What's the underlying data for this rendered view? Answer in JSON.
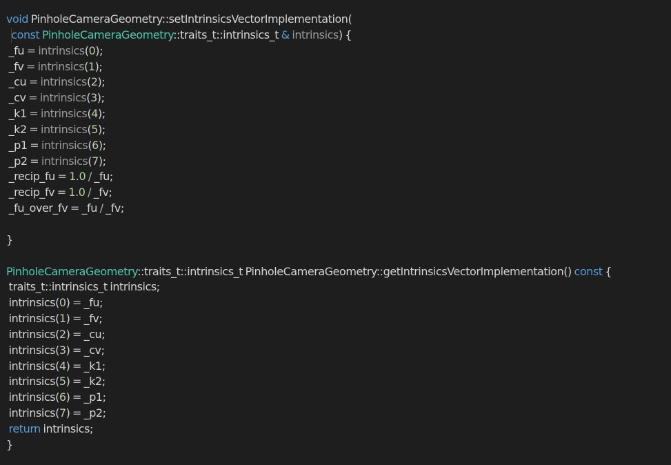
{
  "theme": {
    "background": "#1e1e1e",
    "keyword": "#569cd6",
    "type": "#4ec9b0",
    "text": "#d4d4d4",
    "number": "#b5cea8",
    "muted": "#9a9a9a"
  },
  "code": {
    "lines": [
      [
        {
          "t": "void",
          "c": "kw"
        },
        {
          "t": " PinholeCameraGeometry::setIntrinsicsVectorImplementation(",
          "c": "plain"
        }
      ],
      [
        {
          "t": "  ",
          "c": "plain",
          "guide": true
        },
        {
          "t": "const",
          "c": "kw"
        },
        {
          "t": " ",
          "c": "plain"
        },
        {
          "t": "PinholeCameraGeometry",
          "c": "type"
        },
        {
          "t": "::traits_t::intrinsics_t ",
          "c": "plain"
        },
        {
          "t": "&",
          "c": "kw"
        },
        {
          "t": " ",
          "c": "plain"
        },
        {
          "t": "intrinsics",
          "c": "param"
        },
        {
          "t": ") {",
          "c": "plain"
        }
      ],
      [
        {
          "t": " _fu ",
          "c": "plain"
        },
        {
          "t": "=",
          "c": "op"
        },
        {
          "t": " ",
          "c": "plain"
        },
        {
          "t": "intrinsics",
          "c": "param"
        },
        {
          "t": "(",
          "c": "plain"
        },
        {
          "t": "0",
          "c": "num"
        },
        {
          "t": ");",
          "c": "plain"
        }
      ],
      [
        {
          "t": " _fv ",
          "c": "plain"
        },
        {
          "t": "=",
          "c": "op"
        },
        {
          "t": " ",
          "c": "plain"
        },
        {
          "t": "intrinsics",
          "c": "param"
        },
        {
          "t": "(",
          "c": "plain"
        },
        {
          "t": "1",
          "c": "num"
        },
        {
          "t": ");",
          "c": "plain"
        }
      ],
      [
        {
          "t": " _cu ",
          "c": "plain"
        },
        {
          "t": "=",
          "c": "op"
        },
        {
          "t": " ",
          "c": "plain"
        },
        {
          "t": "intrinsics",
          "c": "param"
        },
        {
          "t": "(",
          "c": "plain"
        },
        {
          "t": "2",
          "c": "num"
        },
        {
          "t": ");",
          "c": "plain"
        }
      ],
      [
        {
          "t": " _cv ",
          "c": "plain"
        },
        {
          "t": "=",
          "c": "op"
        },
        {
          "t": " ",
          "c": "plain"
        },
        {
          "t": "intrinsics",
          "c": "param"
        },
        {
          "t": "(",
          "c": "plain"
        },
        {
          "t": "3",
          "c": "num"
        },
        {
          "t": ");",
          "c": "plain"
        }
      ],
      [
        {
          "t": " _k1 ",
          "c": "plain"
        },
        {
          "t": "=",
          "c": "op"
        },
        {
          "t": " ",
          "c": "plain"
        },
        {
          "t": "intrinsics",
          "c": "param"
        },
        {
          "t": "(",
          "c": "plain"
        },
        {
          "t": "4",
          "c": "num"
        },
        {
          "t": ");",
          "c": "plain"
        }
      ],
      [
        {
          "t": " _k2 ",
          "c": "plain"
        },
        {
          "t": "=",
          "c": "op"
        },
        {
          "t": " ",
          "c": "plain"
        },
        {
          "t": "intrinsics",
          "c": "param"
        },
        {
          "t": "(",
          "c": "plain"
        },
        {
          "t": "5",
          "c": "num"
        },
        {
          "t": ");",
          "c": "plain"
        }
      ],
      [
        {
          "t": " _p1 ",
          "c": "plain"
        },
        {
          "t": "=",
          "c": "op"
        },
        {
          "t": " ",
          "c": "plain"
        },
        {
          "t": "intrinsics",
          "c": "param"
        },
        {
          "t": "(",
          "c": "plain"
        },
        {
          "t": "6",
          "c": "num"
        },
        {
          "t": ");",
          "c": "plain"
        }
      ],
      [
        {
          "t": " _p2 ",
          "c": "plain"
        },
        {
          "t": "=",
          "c": "op"
        },
        {
          "t": " ",
          "c": "plain"
        },
        {
          "t": "intrinsics",
          "c": "param"
        },
        {
          "t": "(",
          "c": "plain"
        },
        {
          "t": "7",
          "c": "num"
        },
        {
          "t": ");",
          "c": "plain"
        }
      ],
      [
        {
          "t": " _recip_fu ",
          "c": "plain"
        },
        {
          "t": "=",
          "c": "op"
        },
        {
          "t": " ",
          "c": "plain"
        },
        {
          "t": "1.0",
          "c": "num"
        },
        {
          "t": " ",
          "c": "plain"
        },
        {
          "t": "/",
          "c": "op"
        },
        {
          "t": " _fu;",
          "c": "plain"
        }
      ],
      [
        {
          "t": " _recip_fv ",
          "c": "plain"
        },
        {
          "t": "=",
          "c": "op"
        },
        {
          "t": " ",
          "c": "plain"
        },
        {
          "t": "1.0",
          "c": "num"
        },
        {
          "t": " ",
          "c": "plain"
        },
        {
          "t": "/",
          "c": "op"
        },
        {
          "t": " _fv;",
          "c": "plain"
        }
      ],
      [
        {
          "t": " _fu_over_fv ",
          "c": "plain"
        },
        {
          "t": "=",
          "c": "op"
        },
        {
          "t": " _fu ",
          "c": "plain"
        },
        {
          "t": "/",
          "c": "op"
        },
        {
          "t": " _fv;",
          "c": "plain"
        }
      ],
      [],
      [
        {
          "t": "}",
          "c": "plain"
        }
      ],
      [],
      [
        {
          "t": "PinholeCameraGeometry",
          "c": "type"
        },
        {
          "t": "::traits_t::intrinsics_t PinholeCameraGeometry::getIntrinsicsVectorImplementation() ",
          "c": "plain"
        },
        {
          "t": "const",
          "c": "kw"
        },
        {
          "t": " {",
          "c": "plain"
        }
      ],
      [
        {
          "t": " traits_t::intrinsics_t intrinsics;",
          "c": "plain"
        }
      ],
      [
        {
          "t": " intrinsics(",
          "c": "plain"
        },
        {
          "t": "0",
          "c": "num"
        },
        {
          "t": ") ",
          "c": "plain"
        },
        {
          "t": "=",
          "c": "op"
        },
        {
          "t": " _fu;",
          "c": "plain"
        }
      ],
      [
        {
          "t": " intrinsics(",
          "c": "plain"
        },
        {
          "t": "1",
          "c": "num"
        },
        {
          "t": ") ",
          "c": "plain"
        },
        {
          "t": "=",
          "c": "op"
        },
        {
          "t": " _fv;",
          "c": "plain"
        }
      ],
      [
        {
          "t": " intrinsics(",
          "c": "plain"
        },
        {
          "t": "2",
          "c": "num"
        },
        {
          "t": ") ",
          "c": "plain"
        },
        {
          "t": "=",
          "c": "op"
        },
        {
          "t": " _cu;",
          "c": "plain"
        }
      ],
      [
        {
          "t": " intrinsics(",
          "c": "plain"
        },
        {
          "t": "3",
          "c": "num"
        },
        {
          "t": ") ",
          "c": "plain"
        },
        {
          "t": "=",
          "c": "op"
        },
        {
          "t": " _cv;",
          "c": "plain"
        }
      ],
      [
        {
          "t": " intrinsics(",
          "c": "plain"
        },
        {
          "t": "4",
          "c": "num"
        },
        {
          "t": ") ",
          "c": "plain"
        },
        {
          "t": "=",
          "c": "op"
        },
        {
          "t": " _k1;",
          "c": "plain"
        }
      ],
      [
        {
          "t": " intrinsics(",
          "c": "plain"
        },
        {
          "t": "5",
          "c": "num"
        },
        {
          "t": ") ",
          "c": "plain"
        },
        {
          "t": "=",
          "c": "op"
        },
        {
          "t": " _k2;",
          "c": "plain"
        }
      ],
      [
        {
          "t": " intrinsics(",
          "c": "plain"
        },
        {
          "t": "6",
          "c": "num"
        },
        {
          "t": ") ",
          "c": "plain"
        },
        {
          "t": "=",
          "c": "op"
        },
        {
          "t": " _p1;",
          "c": "plain"
        }
      ],
      [
        {
          "t": " intrinsics(",
          "c": "plain"
        },
        {
          "t": "7",
          "c": "num"
        },
        {
          "t": ") ",
          "c": "plain"
        },
        {
          "t": "=",
          "c": "op"
        },
        {
          "t": " _p2;",
          "c": "plain"
        }
      ],
      [
        {
          "t": " ",
          "c": "plain"
        },
        {
          "t": "return",
          "c": "kw"
        },
        {
          "t": " intrinsics;",
          "c": "plain"
        }
      ],
      [
        {
          "t": "}",
          "c": "plain"
        }
      ]
    ]
  }
}
